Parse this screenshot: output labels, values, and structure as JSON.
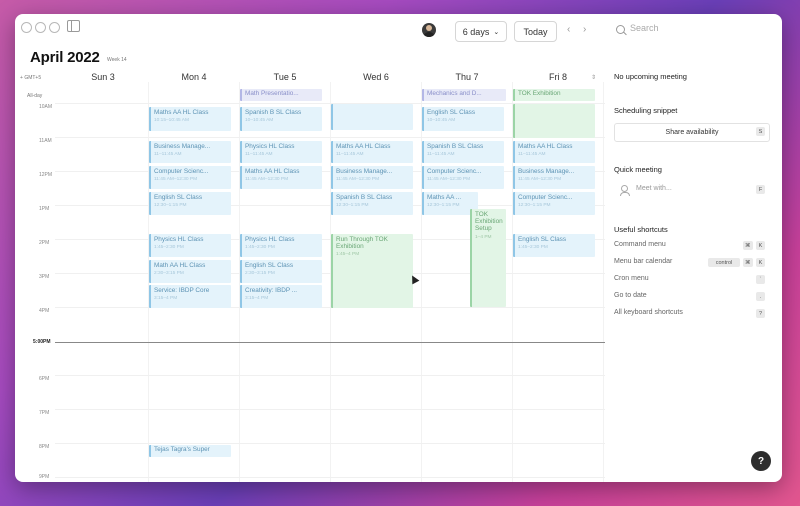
{
  "header": {
    "view_selector": "6 days",
    "today_button": "Today",
    "search_placeholder": "Search"
  },
  "calendar": {
    "month_title": "April 2022",
    "week_label": "Week 14",
    "timezone": "GMT+5",
    "allday_label": "All-day",
    "days": [
      "Sun 3",
      "Mon 4",
      "Tue 5",
      "Wed 6",
      "Thu 7",
      "Fri 8"
    ],
    "hours": [
      "10AM",
      "11AM",
      "12PM",
      "1PM",
      "2PM",
      "3PM",
      "4PM",
      "5PM",
      "6PM",
      "7PM",
      "8PM",
      "9PM"
    ],
    "now_label": "5:00PM",
    "events": [
      {
        "title": "Math Presentatio...",
        "time": ""
      },
      {
        "title": "Mechanics and D...",
        "time": ""
      },
      {
        "title": "TOK Exhibition",
        "time": ""
      },
      {
        "title": "Maths AA HL Class",
        "time": "10:15–10:45 AM"
      },
      {
        "title": "Spanish B SL Class",
        "time": "10–10:45 AM"
      },
      {
        "title": "English SL Class",
        "time": "10–10:45 AM"
      },
      {
        "title": "Business Manage...",
        "time": "11–11:45 AM"
      },
      {
        "title": "Physics HL Class",
        "time": "11–11:45 AM"
      },
      {
        "title": "Maths AA HL Class",
        "time": "11–11:45 AM"
      },
      {
        "title": "Spanish B SL Class",
        "time": "11–11:45 AM"
      },
      {
        "title": "Maths AA HL Class",
        "time": "11–11:45 AM"
      },
      {
        "title": "Computer Scienc...",
        "time": "11:45 AM–12:30 PM"
      },
      {
        "title": "Maths AA HL Class",
        "time": "11:45 AM–12:30 PM"
      },
      {
        "title": "Business Manage...",
        "time": "11:45 AM–12:30 PM"
      },
      {
        "title": "Computer Scienc...",
        "time": "11:45 AM–12:30 PM"
      },
      {
        "title": "Business Manage...",
        "time": "11:45 AM–12:30 PM"
      },
      {
        "title": "English SL Class",
        "time": "12:30–1:15 PM"
      },
      {
        "title": "Spanish B SL Class",
        "time": "12:30–1:15 PM"
      },
      {
        "title": "Maths AA ...",
        "time": "12:30–1:15 PM"
      },
      {
        "title": "Computer Scienc...",
        "time": "12:30–1:15 PM"
      },
      {
        "title": "TOK Exhibition Setup",
        "time": "1–4 PM"
      },
      {
        "title": "Physics HL Class",
        "time": "1:45–2:30 PM"
      },
      {
        "title": "Physics HL Class",
        "time": "1:45–2:30 PM"
      },
      {
        "title": "Run Through TOK Exhibition",
        "time": "1:45–4 PM"
      },
      {
        "title": "English SL Class",
        "time": "1:45–2:30 PM"
      },
      {
        "title": "Math AA HL Class",
        "time": "2:30–3:15 PM"
      },
      {
        "title": "English SL Class",
        "time": "2:30–3:15 PM"
      },
      {
        "title": "Service: IBDP Core",
        "time": "3:15–4 PM"
      },
      {
        "title": "Creativity: IBDP ...",
        "time": "3:15–4 PM"
      },
      {
        "title": "Tejas Tagra's Super",
        "time": ""
      }
    ]
  },
  "panel": {
    "no_upcoming": "No upcoming meeting",
    "snippet_heading": "Scheduling snippet",
    "share_button": "Share availability",
    "share_key": "S",
    "quick_heading": "Quick meeting",
    "meet_placeholder": "Meet with...",
    "meet_key": "F",
    "shortcuts_heading": "Useful shortcuts",
    "shortcuts": [
      {
        "label": "Command menu",
        "keys": [
          "⌘",
          "K"
        ]
      },
      {
        "label": "Menu bar calendar",
        "keys": [
          "control",
          "⌘",
          "K"
        ]
      },
      {
        "label": "Cron menu",
        "keys": [
          "`"
        ]
      },
      {
        "label": "Go to date",
        "keys": [
          "."
        ]
      },
      {
        "label": "All keyboard shortcuts",
        "keys": [
          "?"
        ]
      }
    ],
    "help": "?"
  }
}
